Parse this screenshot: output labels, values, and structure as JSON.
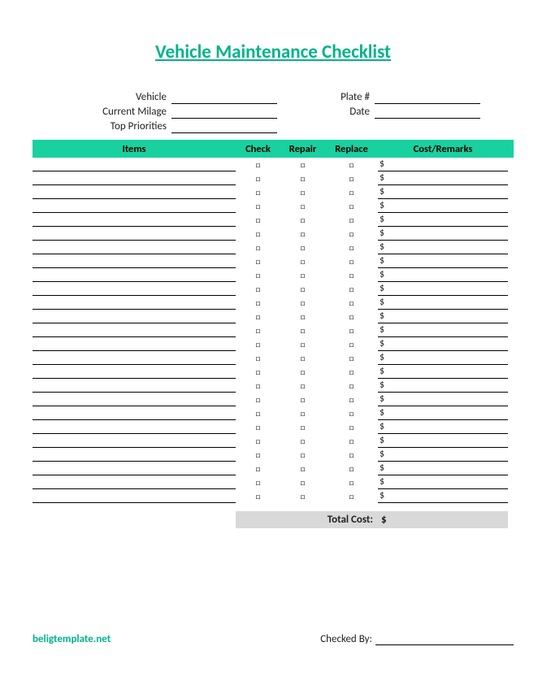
{
  "title": "Vehicle Maintenance Checklist",
  "info": {
    "vehicle_label": "Vehicle",
    "milage_label": "Current Milage",
    "priorities_label": "Top Priorities",
    "plate_label": "Plate #",
    "date_label": "Date",
    "vehicle_value": "",
    "milage_value": "",
    "priorities_value": "",
    "plate_value": "",
    "date_value": ""
  },
  "columns": {
    "items": "Items",
    "check": "Check",
    "repair": "Repair",
    "replace": "Replace",
    "cost": "Cost/Remarks"
  },
  "checkbox_glyph": "□",
  "currency": "$",
  "row_count": 25,
  "total": {
    "label": "Total Cost:",
    "value": "$"
  },
  "footer": {
    "brand": "beligtemplate.net",
    "checked_by_label": "Checked By:",
    "checked_by_value": ""
  }
}
